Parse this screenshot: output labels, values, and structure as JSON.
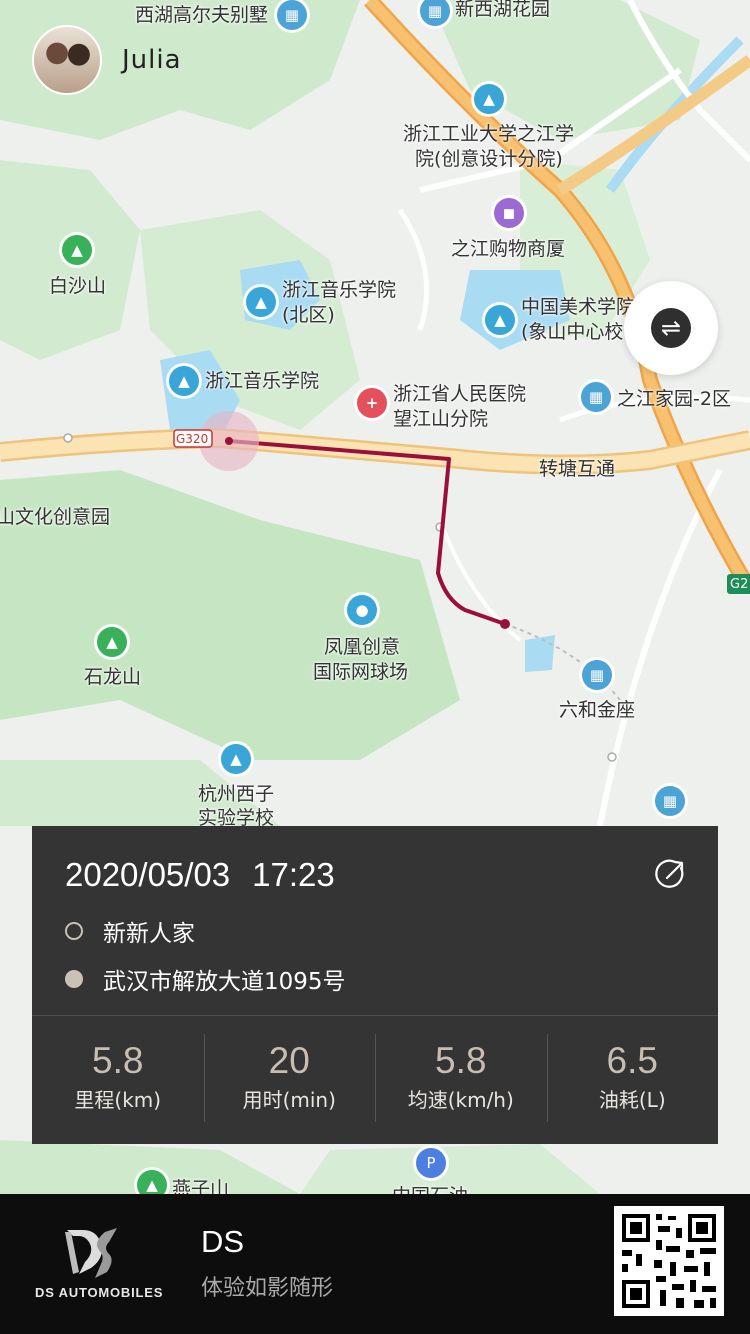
{
  "user": {
    "name": "Julia"
  },
  "map": {
    "labels": {
      "xihu_villa": "西湖高尔夫别墅",
      "xinxihu": "新西湖花园",
      "zjut1": "浙江工业大学之江学",
      "zjut2": "院(创意设计分院)",
      "mall": "之江购物商厦",
      "baishashan": "白沙山",
      "music_north1": "浙江音乐学院",
      "music_north2": "(北区)",
      "academy1": "中国美术学院",
      "academy2": "(象山中心校",
      "music": "浙江音乐学院",
      "hospital1": "浙江省人民医院",
      "hospital2": "望江山分院",
      "zhijiang": "之江家园-2区",
      "road_g320": "G320",
      "road_g25": "G2",
      "zhuantang": "转塘互通",
      "culture_park": "山文化创意园",
      "tennis1": "凤凰创意",
      "tennis2": "国际网球场",
      "shilongshan": "石龙山",
      "liuhe": "六和金座",
      "school1": "杭州西子",
      "school2": "实验学校",
      "yanzishan": "燕子山",
      "petrol": "中国石油"
    }
  },
  "trip": {
    "date": "2020/05/03",
    "time": "17:23",
    "start_location": "新新人家",
    "end_location": "武汉市解放大道1095号",
    "stats": [
      {
        "value": "5.8",
        "label": "里程(km)"
      },
      {
        "value": "20",
        "label": "用时(min)"
      },
      {
        "value": "5.8",
        "label": "均速(km/h)"
      },
      {
        "value": "6.5",
        "label": "油耗(L)"
      }
    ]
  },
  "footer": {
    "brand": "DS AUTOMOBILES",
    "title": "DS",
    "subtitle": "体验如影随形"
  },
  "colors": {
    "route": "#9b0f3b",
    "highway": "#f6b35b",
    "card_bg": "#333433",
    "footer_bg": "#0d0d0d",
    "stat_value": "#c8bdb3"
  },
  "icons": [
    "share-icon",
    "switch-icon",
    "hospital-icon",
    "school-icon",
    "mountain-icon",
    "shopping-icon",
    "building-icon",
    "petrol-icon",
    "qr-code"
  ]
}
